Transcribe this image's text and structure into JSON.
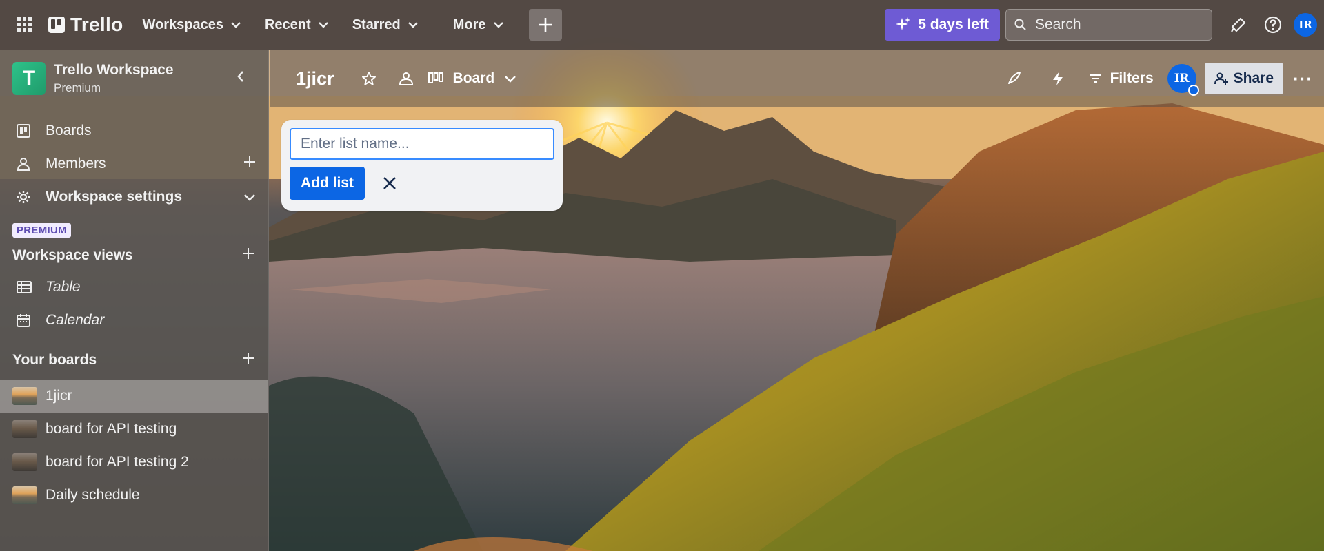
{
  "topbar": {
    "app_name": "Trello",
    "menus": [
      "Workspaces",
      "Recent",
      "Starred",
      "More"
    ],
    "trial_label": "5 days left",
    "search_placeholder": "Search",
    "user_initials": "IR"
  },
  "sidebar": {
    "workspace_name": "Trello Workspace",
    "workspace_plan": "Premium",
    "workspace_initial": "T",
    "nav": {
      "boards": "Boards",
      "members": "Members",
      "settings": "Workspace settings"
    },
    "premium_tag": "PREMIUM",
    "views_title": "Workspace views",
    "views": [
      "Table",
      "Calendar"
    ],
    "boards_title": "Your boards",
    "boards": [
      "1jicr",
      "board for API testing",
      "board for API testing 2",
      "Daily schedule"
    ]
  },
  "board": {
    "title": "1jicr",
    "view_label": "Board",
    "filters_label": "Filters",
    "member_initials": "IR",
    "share_label": "Share",
    "more_label": "···"
  },
  "composer": {
    "placeholder": "Enter list name...",
    "add_label": "Add list"
  },
  "colors": {
    "accent": "#0c66e4",
    "trial": "#6e5bd4",
    "workspace_logo": "#1f9b6b",
    "premium_tag_text": "#5e4db2"
  }
}
